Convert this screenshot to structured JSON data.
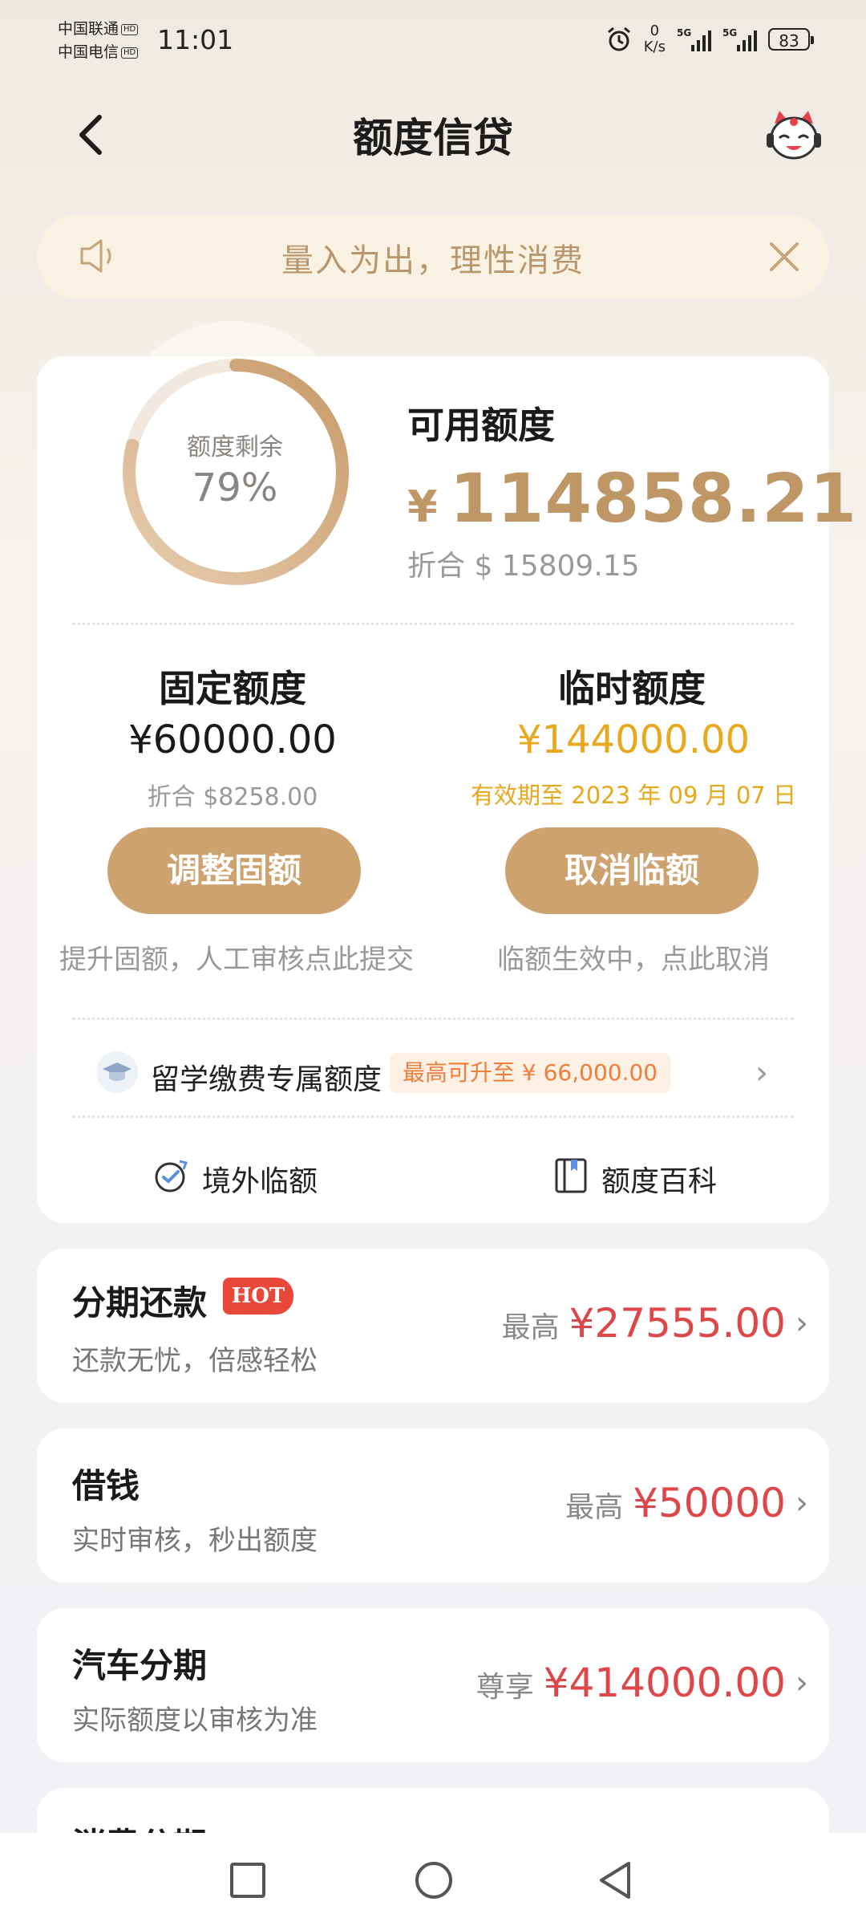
{
  "status_bar": {
    "carrier1": "中国联通",
    "carrier2": "中国电信",
    "hd": "HD",
    "time": "11:01",
    "net_speed_value": "0",
    "net_speed_unit": "K/s",
    "signal1": "5G",
    "signal2": "5G",
    "battery": "83"
  },
  "header": {
    "title": "额度信贷",
    "back_icon": "chevron-left-icon",
    "assistant_icon": "mascot-avatar-icon"
  },
  "notice": {
    "text": "量入为出，理性消费",
    "speaker_icon": "speaker-icon",
    "close_icon": "close-icon"
  },
  "summary": {
    "ring_label": "额度剩余",
    "ring_percent": "79%",
    "ring_fraction": 0.79,
    "available_label": "可用额度",
    "available_currency": "¥",
    "available_amount": "114858.21",
    "available_usd": "折合 $ 15809.15",
    "fixed": {
      "label": "固定额度",
      "amount": "¥60000.00",
      "usd": "折合 $8258.00",
      "button": "调整固额",
      "hint": "提升固额，人工审核点此提交"
    },
    "temporary": {
      "label": "临时额度",
      "amount": "¥144000.00",
      "valid_until": "有效期至 2023 年 09 月 07 日",
      "button": "取消临额",
      "hint": "临额生效中，点此取消"
    },
    "study": {
      "text": "留学缴费专属额度",
      "badge": "最高可升至 ¥ 66,000.00"
    },
    "links": [
      {
        "label": "境外临额",
        "icon": "overseas-limit-icon"
      },
      {
        "label": "额度百科",
        "icon": "book-icon"
      }
    ]
  },
  "products": [
    {
      "title": "分期还款",
      "badge": "HOT",
      "subtitle": "还款无忧，倍感轻松",
      "prefix": "最高",
      "amount": "¥27555.00"
    },
    {
      "title": "借钱",
      "subtitle": "实时审核，秒出额度",
      "prefix": "最高",
      "amount": "¥50000"
    },
    {
      "title": "汽车分期",
      "subtitle": "实际额度以审核为准",
      "prefix": "尊享",
      "amount": "¥414000.00"
    },
    {
      "title": "消费分期"
    }
  ],
  "colors": {
    "accent_gold": "#cda26e",
    "amount_gold": "#bf9766",
    "temp_amount": "#e7a81d",
    "price_red": "#dd4749"
  }
}
